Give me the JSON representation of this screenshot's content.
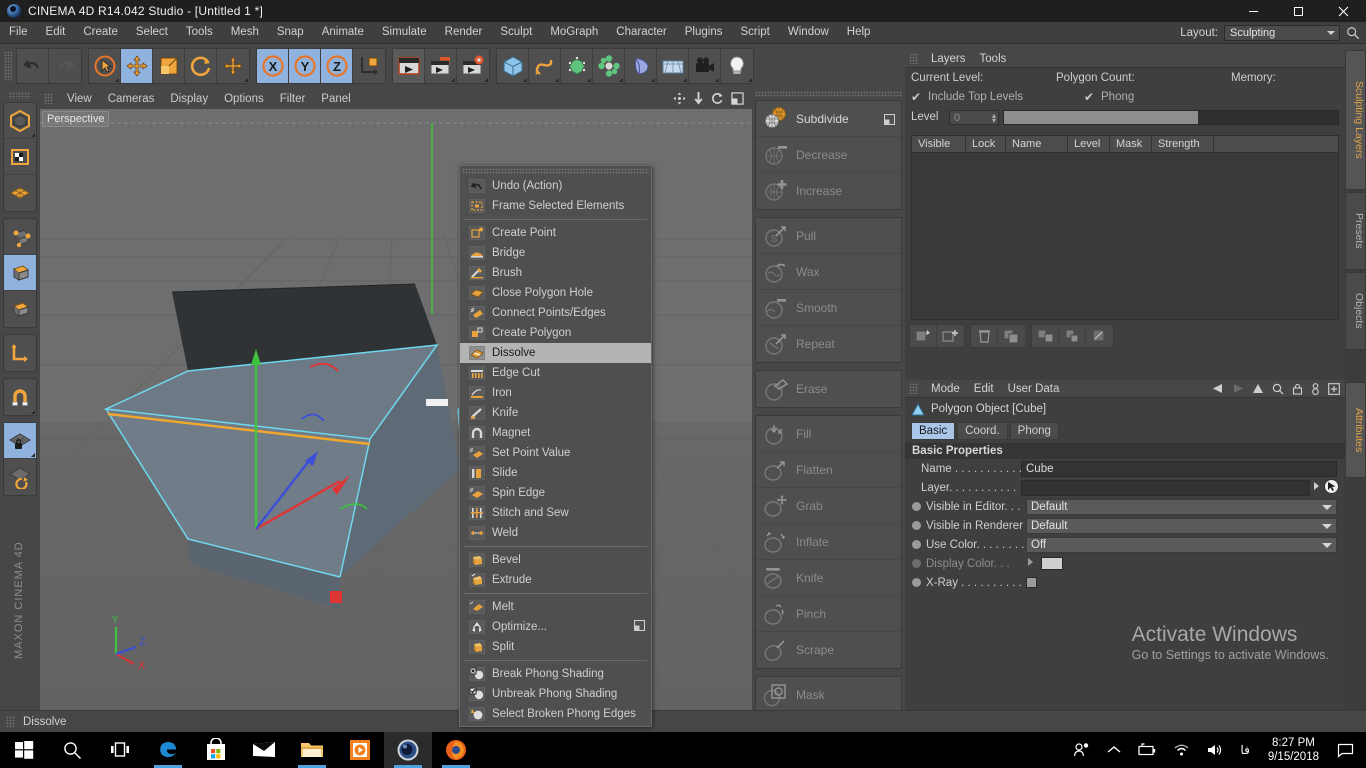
{
  "titlebar": {
    "title": "CINEMA 4D R14.042 Studio - [Untitled 1 *]",
    "minimize": "–",
    "maximize": "□",
    "close": "✕"
  },
  "menubar": {
    "items": [
      "File",
      "Edit",
      "Create",
      "Select",
      "Tools",
      "Mesh",
      "Snap",
      "Animate",
      "Simulate",
      "Render",
      "Sculpt",
      "MoGraph",
      "Character",
      "Plugins",
      "Script",
      "Window",
      "Help"
    ],
    "layout_label": "Layout:",
    "layout_value": "Sculpting",
    "search_icon": "search-icon"
  },
  "viewport": {
    "menu": [
      "View",
      "Cameras",
      "Display",
      "Options",
      "Filter",
      "Panel"
    ],
    "label": "Perspective",
    "axes": {
      "x": "X",
      "y": "Y",
      "z": "Z"
    },
    "brand": "MAXON CINEMA 4D"
  },
  "context_menu": {
    "groups": [
      [
        {
          "label": "Undo (Action)",
          "icon": "undo-icon",
          "selected": false
        },
        {
          "label": "Frame Selected Elements",
          "icon": "frame-selected-icon",
          "selected": false
        }
      ],
      [
        {
          "label": "Create Point",
          "icon": "create-point-icon",
          "selected": false
        },
        {
          "label": "Bridge",
          "icon": "bridge-icon",
          "selected": false
        },
        {
          "label": "Brush",
          "icon": "brush-icon",
          "selected": false
        },
        {
          "label": "Close Polygon Hole",
          "icon": "close-polygon-hole-icon",
          "selected": false
        },
        {
          "label": "Connect Points/Edges",
          "icon": "connect-points-icon",
          "selected": false
        },
        {
          "label": "Create Polygon",
          "icon": "create-polygon-icon",
          "selected": false
        },
        {
          "label": "Dissolve",
          "icon": "dissolve-icon",
          "selected": true
        },
        {
          "label": "Edge Cut",
          "icon": "edge-cut-icon",
          "selected": false
        },
        {
          "label": "Iron",
          "icon": "iron-icon",
          "selected": false
        },
        {
          "label": "Knife",
          "icon": "knife-icon",
          "selected": false
        },
        {
          "label": "Magnet",
          "icon": "magnet-icon",
          "selected": false
        },
        {
          "label": "Set Point Value",
          "icon": "set-point-value-icon",
          "selected": false
        },
        {
          "label": "Slide",
          "icon": "slide-icon",
          "selected": false
        },
        {
          "label": "Spin Edge",
          "icon": "spin-edge-icon",
          "selected": false
        },
        {
          "label": "Stitch and Sew",
          "icon": "stitch-sew-icon",
          "selected": false
        },
        {
          "label": "Weld",
          "icon": "weld-icon",
          "selected": false
        }
      ],
      [
        {
          "label": "Bevel",
          "icon": "bevel-icon",
          "selected": false
        },
        {
          "label": "Extrude",
          "icon": "extrude-icon",
          "selected": false
        }
      ],
      [
        {
          "label": "Melt",
          "icon": "melt-icon",
          "selected": false
        },
        {
          "label": "Optimize...",
          "icon": "optimize-icon",
          "selected": false,
          "has_options": true
        },
        {
          "label": "Split",
          "icon": "split-icon",
          "selected": false
        }
      ],
      [
        {
          "label": "Break Phong Shading",
          "icon": "break-phong-icon",
          "selected": false
        },
        {
          "label": "Unbreak Phong Shading",
          "icon": "unbreak-phong-icon",
          "selected": false
        },
        {
          "label": "Select Broken Phong Edges",
          "icon": "select-broken-phong-icon",
          "selected": false
        }
      ]
    ]
  },
  "sculpt_tools": {
    "groups": [
      [
        {
          "label": "Subdivide",
          "enabled": true,
          "has_options": true
        },
        {
          "label": "Decrease",
          "enabled": false
        },
        {
          "label": "Increase",
          "enabled": false
        }
      ],
      [
        {
          "label": "Pull",
          "enabled": false
        },
        {
          "label": "Wax",
          "enabled": false
        },
        {
          "label": "Smooth",
          "enabled": false
        },
        {
          "label": "Repeat",
          "enabled": false
        }
      ],
      [
        {
          "label": "Erase",
          "enabled": false
        }
      ],
      [
        {
          "label": "Fill",
          "enabled": false
        },
        {
          "label": "Flatten",
          "enabled": false
        },
        {
          "label": "Grab",
          "enabled": false
        },
        {
          "label": "Inflate",
          "enabled": false
        },
        {
          "label": "Knife",
          "enabled": false
        },
        {
          "label": "Pinch",
          "enabled": false
        },
        {
          "label": "Scrape",
          "enabled": false
        }
      ],
      [
        {
          "label": "Mask",
          "enabled": false
        }
      ]
    ]
  },
  "layers_panel": {
    "menu": [
      "Layers",
      "Tools"
    ],
    "info": {
      "current_level": "Current Level:",
      "polygon_count": "Polygon Count:",
      "memory": "Memory:"
    },
    "include_top_levels": "Include Top Levels",
    "phong": "Phong",
    "level_label": "Level",
    "level_value": "0",
    "columns": [
      "Visible",
      "Lock",
      "Name",
      "Level",
      "Mask",
      "Strength"
    ]
  },
  "attributes_panel": {
    "menu": [
      "Mode",
      "Edit",
      "User Data"
    ],
    "object_title": "Polygon Object [Cube]",
    "tabs": [
      {
        "label": "Basic",
        "active": true
      },
      {
        "label": "Coord.",
        "active": false
      },
      {
        "label": "Phong",
        "active": false
      }
    ],
    "section_title": "Basic Properties",
    "properties": [
      {
        "label": "Name . . . . . . . . . . .",
        "type": "text",
        "value": "Cube"
      },
      {
        "label": "Layer. . . . . . . . . . .",
        "type": "layer",
        "value": ""
      },
      {
        "label": "Visible in Editor. . .",
        "type": "dropdown",
        "value": "Default"
      },
      {
        "label": "Visible in Renderer",
        "type": "dropdown",
        "value": "Default"
      },
      {
        "label": "Use Color. . . . . . . .",
        "type": "dropdown",
        "value": "Off"
      },
      {
        "label": "Display Color. . .",
        "type": "swatch",
        "value": "",
        "dim": true
      },
      {
        "label": "X-Ray . . . . . . . . . .",
        "type": "checkbox",
        "value": ""
      }
    ]
  },
  "vertical_tabs": [
    {
      "label": "Sculpting Layers",
      "accent": true
    },
    {
      "label": "Presets",
      "accent": false
    },
    {
      "label": "Objects",
      "accent": false
    },
    {
      "label": "Attributes",
      "accent": true
    }
  ],
  "watermark": {
    "line1": "Activate Windows",
    "line2": "Go to Settings to activate Windows."
  },
  "statusbar": {
    "text": "Dissolve"
  },
  "taskbar": {
    "items": [
      {
        "name": "start-button",
        "icon": "windows-logo-icon"
      },
      {
        "name": "search-button",
        "icon": "search-icon"
      },
      {
        "name": "task-view-button",
        "icon": "task-view-icon"
      },
      {
        "name": "edge-button",
        "icon": "edge-icon",
        "running": true
      },
      {
        "name": "store-button",
        "icon": "store-icon"
      },
      {
        "name": "mail-button",
        "icon": "mail-icon"
      },
      {
        "name": "explorer-button",
        "icon": "folder-icon",
        "running": true
      },
      {
        "name": "media-player-button",
        "icon": "media-player-icon"
      },
      {
        "name": "cinema4d-button",
        "icon": "cinema4d-icon",
        "running": true,
        "active": true
      },
      {
        "name": "firefox-button",
        "icon": "firefox-icon",
        "running": true
      }
    ],
    "tray": {
      "people_icon": "people-icon",
      "chevron_icon": "chevron-up-icon",
      "battery_icon": "battery-icon",
      "network_icon": "wifi-icon",
      "volume_icon": "speaker-icon",
      "ime": "فا",
      "time": "8:27 PM",
      "date": "9/15/2018",
      "action_center_icon": "notification-icon"
    }
  },
  "colors": {
    "accent_orange": "#e8a33d",
    "selection_blue": "#8fb3de",
    "panel_bg": "#474747",
    "dark_bg": "#3f3f3f"
  }
}
